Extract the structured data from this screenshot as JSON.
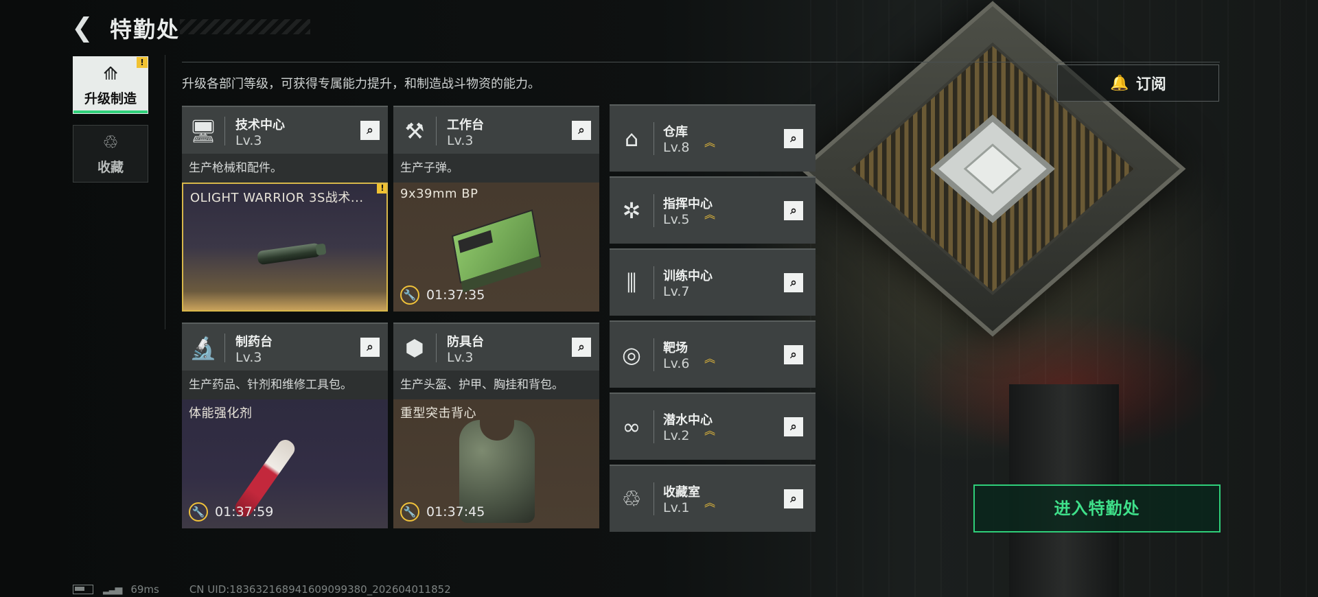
{
  "header": {
    "title": "特勤处"
  },
  "tabs": [
    {
      "label": "升级制造",
      "active": true,
      "alert": "!"
    },
    {
      "label": "收藏",
      "active": false
    }
  ],
  "description": "升级各部门等级，可获得专属能力提升，和制造战斗物资的能力。",
  "subscribe_label": "订阅",
  "production": [
    {
      "name": "技术中心",
      "level": "Lv.3",
      "desc": "生产枪械和配件。",
      "item": "OLIGHT WARRIOR 3S战术...",
      "timer": "",
      "alert": "!"
    },
    {
      "name": "工作台",
      "level": "Lv.3",
      "desc": "生产子弹。",
      "item": "9x39mm BP",
      "timer": "01:37:35"
    },
    {
      "name": "制药台",
      "level": "Lv.3",
      "desc": "生产药品、针剂和维修工具包。",
      "item": "体能强化剂",
      "timer": "01:37:59"
    },
    {
      "name": "防具台",
      "level": "Lv.3",
      "desc": "生产头盔、护甲、胸挂和背包。",
      "item": "重型突击背心",
      "timer": "01:37:45"
    }
  ],
  "facilities": [
    {
      "name": "仓库",
      "level": "Lv.8",
      "upgradable": true
    },
    {
      "name": "指挥中心",
      "level": "Lv.5",
      "upgradable": true
    },
    {
      "name": "训练中心",
      "level": "Lv.7",
      "upgradable": false
    },
    {
      "name": "靶场",
      "level": "Lv.6",
      "upgradable": true
    },
    {
      "name": "潜水中心",
      "level": "Lv.2",
      "upgradable": true
    },
    {
      "name": "收藏室",
      "level": "Lv.1",
      "upgradable": true
    }
  ],
  "enter_label": "进入特勤处",
  "footer": {
    "ping": "69ms",
    "uid": "CN UID:18363216894160909​9380_202604011852"
  },
  "icons": {
    "back": "chevron-left-icon",
    "search": "magnifier-icon",
    "upgrade_arrow": "double-chevron-up-icon",
    "timer": "wrench-clock-icon"
  },
  "colors": {
    "accent_green": "#2fd07a",
    "alert_yellow": "#f1c232"
  }
}
